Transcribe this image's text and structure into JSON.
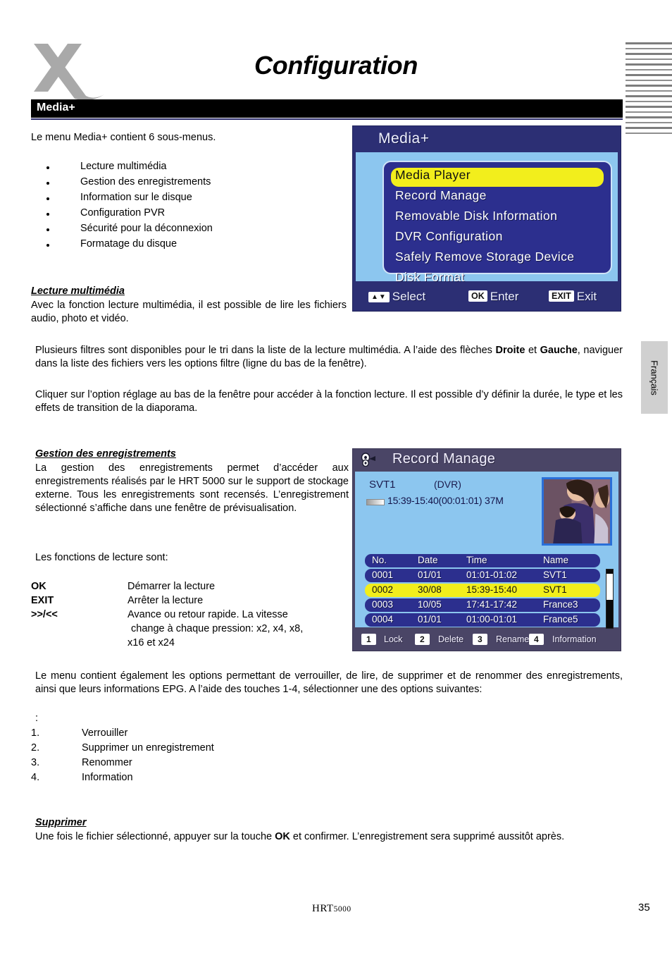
{
  "document": {
    "title": "Configuration",
    "section_heading": "Media+",
    "intro": "Le menu Media+ contient 6 sous-menus.",
    "bullets": [
      "Lecture multimédia",
      "Gestion des enregistrements",
      "Information sur le disque",
      "Configuration PVR",
      "Sécurité pour la déconnexion",
      "Formatage du disque"
    ],
    "heading_lecture": "Lecture multimédia",
    "para_lecture_1": "Avec la fonction lecture multimédia, il est possible de lire les fichiers audio, photo et vidéo.",
    "para_lecture_2_a": "Plusieurs filtres sont disponibles pour le tri dans la liste de la lecture multimédia. A l’aide des flèches ",
    "para_lecture_2_b1": "Droite",
    "para_lecture_2_mid": " et ",
    "para_lecture_2_b2": "Gauche",
    "para_lecture_2_c": ", naviguer dans la liste des fichiers vers les options filtre (ligne du bas de la fenêtre).",
    "para_lecture_3": "Cliquer sur l’option réglage au bas de la fenêtre pour accéder à la fonction lecture. Il est possible d’y définir la durée, le type et les effets de transition de la diaporama.",
    "heading_gestion": "Gestion des enregistrements",
    "para_gestion": "La gestion des enregistrements permet d’accéder aux enregistrements réalisés par le HRT 5000 sur le support de stockage externe. Tous les enregistrements sont recensés. L’enregistrement sélectionné s’affiche dans une fenêtre de prévisualisation.",
    "para_fonctions": "Les fonctions de lecture sont:",
    "key_table": [
      {
        "key": "OK",
        "value": "Démarrer la lecture"
      },
      {
        "key": "EXIT",
        "value": "Arrêter la lecture"
      },
      {
        "key": ">>/<<",
        "value": "Avance ou retour rapide. La vitesse",
        "cont1": "change à chaque pression: x2, x4, x8,",
        "cont2": "x16 et x24"
      }
    ],
    "para_menu_options": "Le menu contient également les options permettant de verrouiller, de lire, de supprimer et de renommer des enregistrements, ainsi que leurs informations EPG. A l’aide des touches 1-4, sélectionner une des options suivantes:",
    "colon_line": ":",
    "numbered": [
      {
        "n": "1.",
        "label": "Verrouiller"
      },
      {
        "n": "2.",
        "label": "Supprimer un enregistrement"
      },
      {
        "n": "3.",
        "label": "Renommer"
      },
      {
        "n": "4.",
        "label": "Information"
      }
    ],
    "heading_supprimer": "Supprimer",
    "para_supprimer_a": "Une fois le fichier sélectionné, appuyer sur la touche ",
    "para_supprimer_b": "OK",
    "para_supprimer_c": " et confirmer. L’enregistrement sera supprimé aussitôt après.",
    "lang_tab": "Français",
    "footer_brand": "HRT",
    "footer_brand_model": "5000",
    "footer_page": "35"
  },
  "tv_media_plus": {
    "title": "Media+",
    "menu_items": [
      "Media Player",
      "Record Manage",
      "Removable Disk Information",
      "DVR Configuration",
      "Safely Remove Storage Device",
      "Disk Format"
    ],
    "selected_index": 0,
    "footer": [
      {
        "keycap": "▲▼",
        "label": "Select"
      },
      {
        "keycap": "OK",
        "label": "Enter"
      },
      {
        "keycap": "EXIT",
        "label": "Exit"
      }
    ]
  },
  "tv_record_manage": {
    "title": "Record Manage",
    "channel": "SVT1",
    "source": "(DVR)",
    "range": "15:39-15:40(00:01:01) 37M",
    "columns": [
      "No.",
      "Date",
      "Time",
      "Name"
    ],
    "rows": [
      {
        "no": "0001",
        "date": "01/01",
        "time": "01:01-01:02",
        "name": "SVT1",
        "selected": false
      },
      {
        "no": "0002",
        "date": "30/08",
        "time": "15:39-15:40",
        "name": "SVT1",
        "selected": true
      },
      {
        "no": "0003",
        "date": "10/05",
        "time": "17:41-17:42",
        "name": "France3",
        "selected": false
      },
      {
        "no": "0004",
        "date": "01/01",
        "time": "01:00-01:01",
        "name": "France5",
        "selected": false
      }
    ],
    "footer": [
      {
        "keycap": "1",
        "label": "Lock"
      },
      {
        "keycap": "2",
        "label": "Delete"
      },
      {
        "keycap": "3",
        "label": "Rename"
      },
      {
        "keycap": "4",
        "label": "Information"
      }
    ]
  },
  "colors": {
    "accent_navy": "#2c2f74",
    "panel_blue": "#2c2f8e",
    "highlight_yellow": "#f2ee1c",
    "sky": "#8cc6ef",
    "record_header": "#4a4566",
    "logo_gray": "#a9a9a9",
    "stripe_gray": "#7d7d7d"
  }
}
